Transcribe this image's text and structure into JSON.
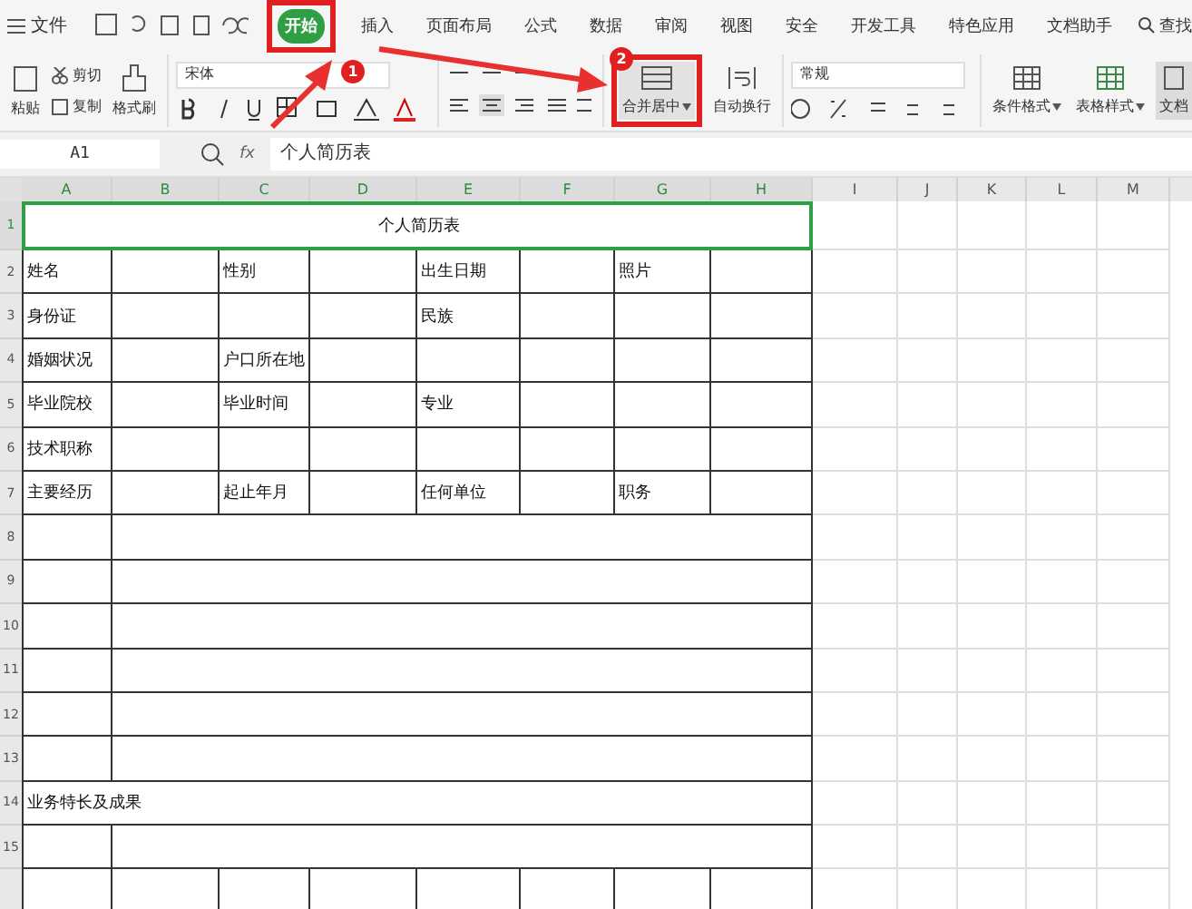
{
  "file_menu": {
    "label": "文件"
  },
  "tabs": [
    {
      "label": "开始",
      "selected": true
    },
    {
      "label": "插入",
      "selected": false
    },
    {
      "label": "页面布局",
      "selected": false
    },
    {
      "label": "公式",
      "selected": false
    },
    {
      "label": "数据",
      "selected": false
    },
    {
      "label": "审阅",
      "selected": false
    },
    {
      "label": "视图",
      "selected": false
    },
    {
      "label": "安全",
      "selected": false
    },
    {
      "label": "开发工具",
      "selected": false
    },
    {
      "label": "特色应用",
      "selected": false
    },
    {
      "label": "文档助手",
      "selected": false
    }
  ],
  "search": {
    "label": "查找"
  },
  "toolbar": {
    "paste": "粘贴",
    "cut": "剪切",
    "copy": "复制",
    "format_painter": "格式刷",
    "font": "宋体",
    "merge": "合并居中",
    "wrap": "自动换行",
    "number_format": "常规",
    "conditional": "条件格式",
    "table_style": "表格样式",
    "doc": "文档"
  },
  "formula_bar": {
    "cell_ref": "A1",
    "fx": "fx",
    "value": "个人简历表"
  },
  "columns": [
    {
      "label": "A",
      "selected": true
    },
    {
      "label": "B",
      "selected": true
    },
    {
      "label": "C",
      "selected": true
    },
    {
      "label": "D",
      "selected": true
    },
    {
      "label": "E",
      "selected": true
    },
    {
      "label": "F",
      "selected": true
    },
    {
      "label": "G",
      "selected": true
    },
    {
      "label": "H",
      "selected": true
    },
    {
      "label": "I",
      "selected": false
    },
    {
      "label": "J",
      "selected": false
    },
    {
      "label": "K",
      "selected": false
    },
    {
      "label": "L",
      "selected": false
    },
    {
      "label": "M",
      "selected": false
    }
  ],
  "rows": [
    {
      "label": "1",
      "kind": "full",
      "selected": true,
      "cells": {
        "A": "个人简历表"
      }
    },
    {
      "label": "2",
      "kind": "grid",
      "selected": false,
      "cells": {
        "A": "姓名",
        "C": "性别",
        "E": "出生日期",
        "G": "照片"
      }
    },
    {
      "label": "3",
      "kind": "grid",
      "selected": false,
      "cells": {
        "A": "身份证",
        "E": "民族"
      }
    },
    {
      "label": "4",
      "kind": "grid",
      "selected": false,
      "cells": {
        "A": "婚姻状况",
        "C": "户口所在地"
      }
    },
    {
      "label": "5",
      "kind": "grid",
      "selected": false,
      "cells": {
        "A": "毕业院校",
        "C": "毕业时间",
        "E": "专业"
      }
    },
    {
      "label": "6",
      "kind": "grid",
      "selected": false,
      "cells": {
        "A": "技术职称"
      }
    },
    {
      "label": "7",
      "kind": "grid",
      "selected": false,
      "cells": {
        "A": "主要经历",
        "C": "起止年月",
        "E": "任何单位",
        "G": "职务"
      }
    },
    {
      "label": "8",
      "kind": "split",
      "selected": false
    },
    {
      "label": "9",
      "kind": "split",
      "selected": false
    },
    {
      "label": "10",
      "kind": "split",
      "selected": false
    },
    {
      "label": "11",
      "kind": "split",
      "selected": false
    },
    {
      "label": "12",
      "kind": "split",
      "selected": false
    },
    {
      "label": "13",
      "kind": "split",
      "selected": false
    },
    {
      "label": "14",
      "kind": "full",
      "selected": false,
      "cells": {
        "A": "业务特长及成果"
      }
    },
    {
      "label": "15",
      "kind": "split",
      "selected": false
    }
  ],
  "annotations": [
    {
      "label": "1",
      "kind": "tab"
    },
    {
      "label": "2",
      "kind": "merge"
    }
  ]
}
